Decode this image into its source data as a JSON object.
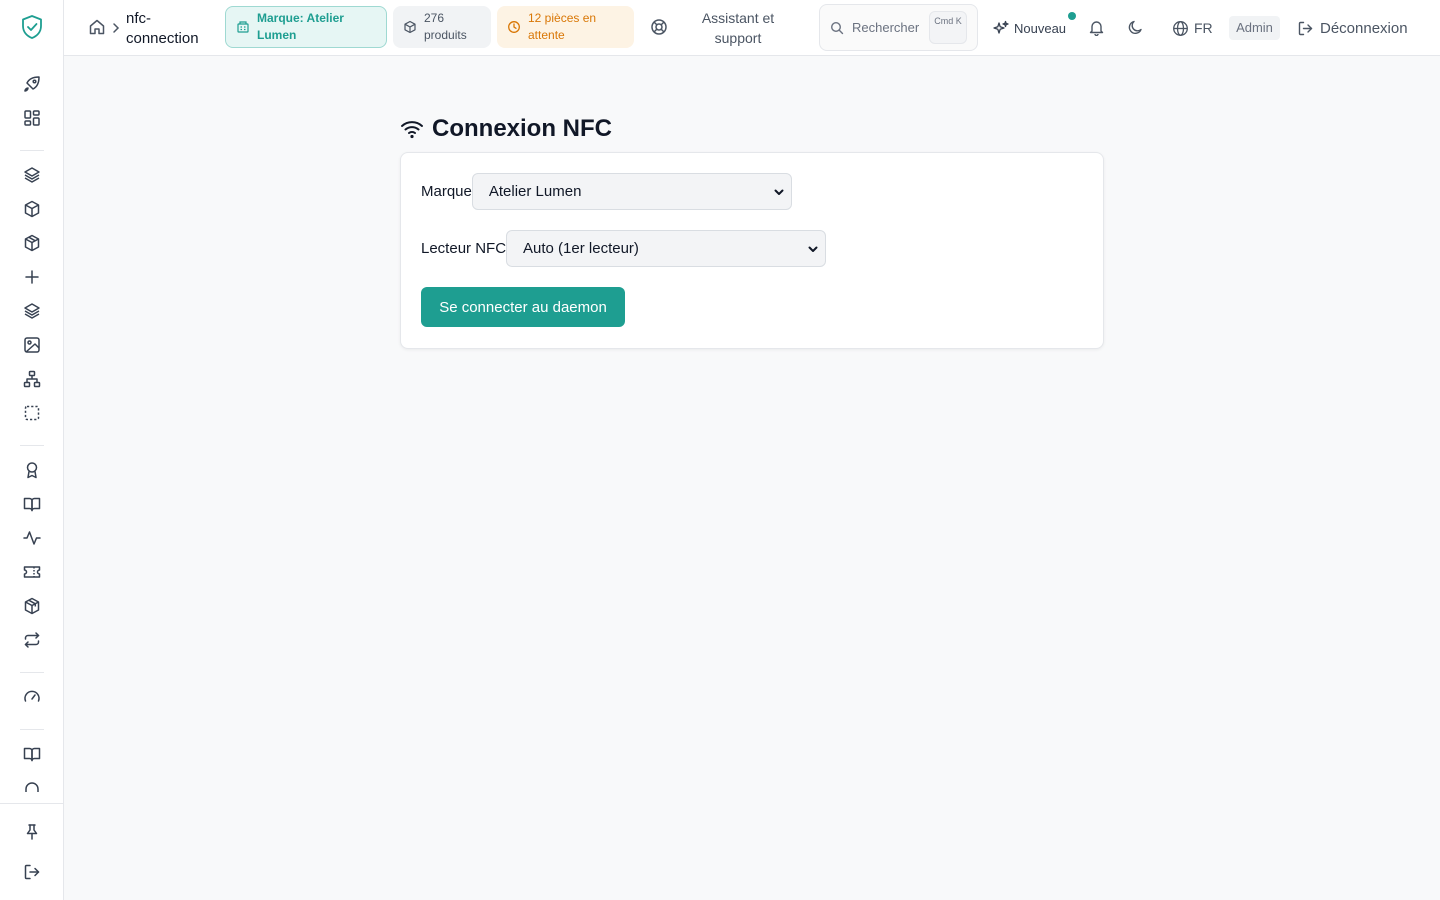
{
  "header": {
    "breadcrumb_title": "nfc-connection",
    "brand_pill": "Marque: Atelier Lumen",
    "products_pill": "276 produits",
    "pending_pill": "12 pièces en attente",
    "assistant_link": "Assistant et support",
    "search": {
      "placeholder": "Rechercher",
      "shortcut": "Cmd K"
    },
    "new_label": "Nouveau",
    "language": "FR",
    "role_badge": "Admin",
    "logout_label": "Déconnexion"
  },
  "sidebar": {
    "icons": [
      "shield-logo-icon",
      "rocket-icon",
      "dashboard-grid-icon",
      "layers-icon",
      "box-icon",
      "box-outline-icon",
      "plus-icon",
      "layers-stack-icon",
      "image-icon",
      "sitemap-icon",
      "dashed-square-icon",
      "award-icon",
      "book-open-icon",
      "activity-icon",
      "ticket-icon",
      "package-icon",
      "repeat-icon",
      "gauge-icon",
      "book-icon",
      "headphones-icon",
      "pin-icon",
      "logout-icon"
    ]
  },
  "main": {
    "title": "Connexion NFC",
    "brand_field": {
      "label": "Marque",
      "value": "Atelier Lumen"
    },
    "reader_field": {
      "label": "Lecteur NFC",
      "value": "Auto (1er lecteur)"
    },
    "connect_button": "Se connecter au daemon"
  },
  "colors": {
    "accent": "#1e9e91",
    "pending": "#d97706",
    "background": "#f8f9fa"
  }
}
